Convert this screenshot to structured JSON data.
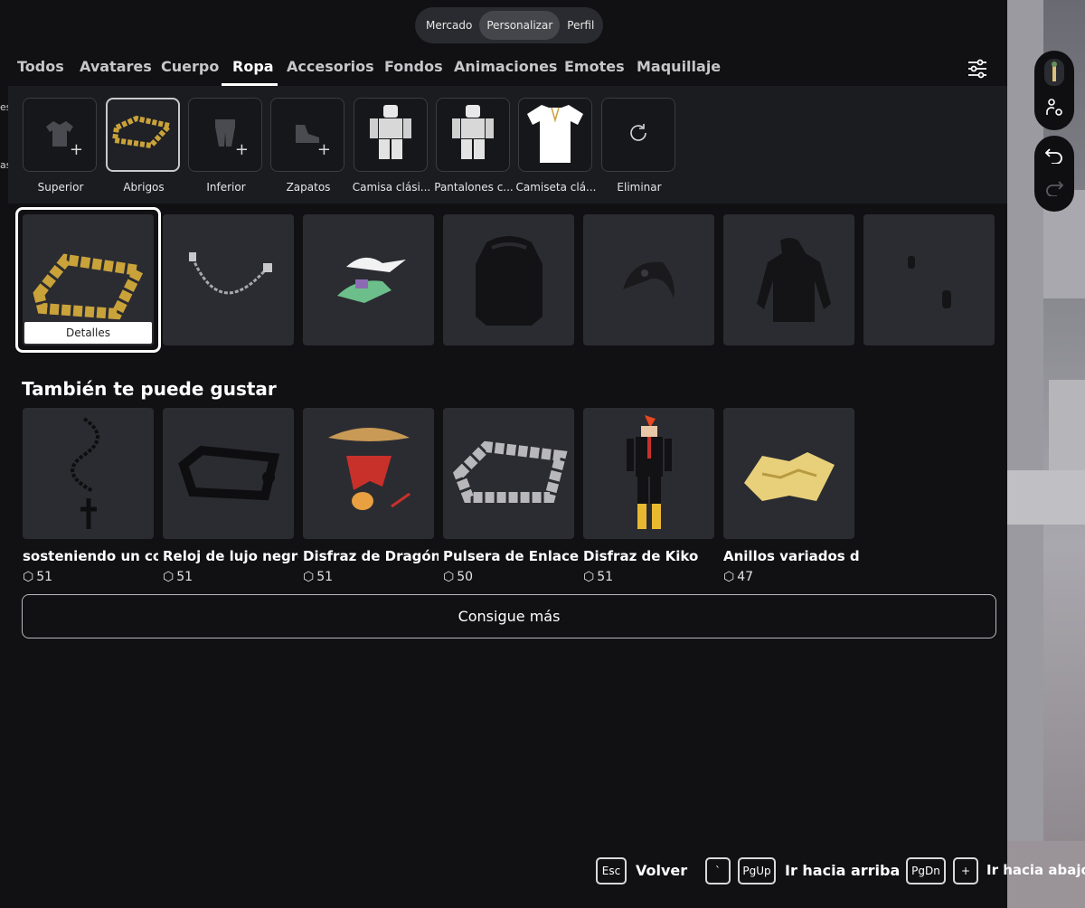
{
  "topnav": {
    "items": [
      {
        "label": "Mercado"
      },
      {
        "label": "Personalizar"
      },
      {
        "label": "Perfil"
      }
    ],
    "active": "Personalizar"
  },
  "tabs": {
    "items": [
      "Todos",
      "Avatares",
      "Cuerpo",
      "Ropa",
      "Accesorios",
      "Fondos",
      "Animaciones",
      "Emotes",
      "Maquillaje"
    ],
    "active": "Ropa"
  },
  "edge_text": [
    "es",
    "as"
  ],
  "subcategories": [
    {
      "label": "Superior",
      "icon": "jacket-icon"
    },
    {
      "label": "Abrigos",
      "icon": "gold-chain-thumb"
    },
    {
      "label": "Inferior",
      "icon": "pants-icon"
    },
    {
      "label": "Zapatos",
      "icon": "shoe-icon"
    },
    {
      "label": "Camisa clási...",
      "icon": "avatar-thumb"
    },
    {
      "label": "Pantalones c...",
      "icon": "avatar-thumb"
    },
    {
      "label": "Camiseta clá...",
      "icon": "tshirt-thumb"
    },
    {
      "label": "Eliminar",
      "icon": "refresh-icon"
    }
  ],
  "equipped": {
    "details_label": "Detalles",
    "items": [
      "gold-chain",
      "silver-chain",
      "winged-crocodile",
      "black-backpack",
      "karambit",
      "black-hoodie",
      "small-parts"
    ]
  },
  "recommendations": {
    "title": "También te puede gustar",
    "items": [
      {
        "name": "sosteniendo un col...",
        "price": "51"
      },
      {
        "name": "Reloj de lujo negro",
        "price": "51"
      },
      {
        "name": "Disfraz de Dragón ...",
        "price": "51"
      },
      {
        "name": "Pulsera de Enlace ...",
        "price": "50"
      },
      {
        "name": "Disfraz de Kiko",
        "price": "51"
      },
      {
        "name": "Anillos variados d...",
        "price": "47"
      }
    ],
    "more_label": "Consigue más"
  },
  "footer": {
    "esc_key": "Esc",
    "back_label": "Volver",
    "tick_key": "`",
    "pgup_key": "PgUp",
    "up_label": "Ir hacia arriba",
    "pgdn_key": "PgDn",
    "plus_key": "+",
    "down_label": "Ir hacia abajo"
  },
  "colors": {
    "background": "#111114",
    "panel": "#1b1c20",
    "card": "#2b2c31",
    "text": "#ffffff"
  }
}
